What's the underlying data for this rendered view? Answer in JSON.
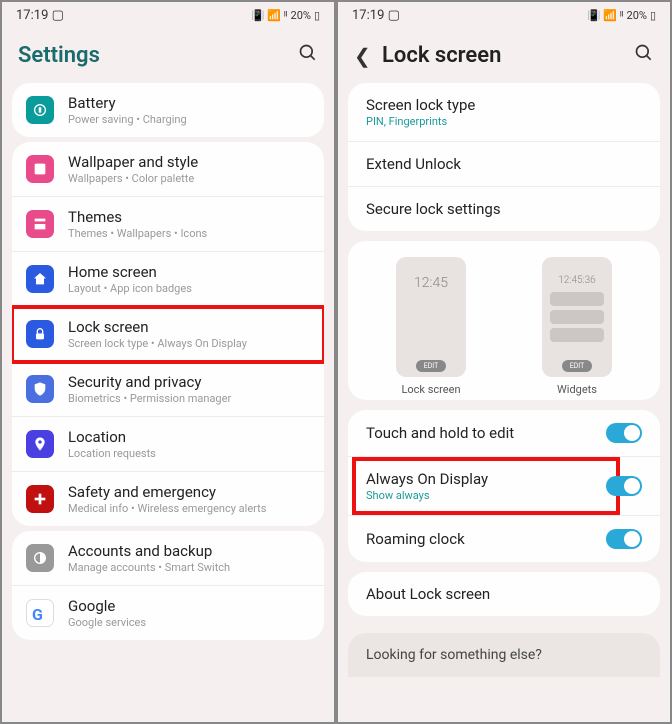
{
  "status": {
    "time": "17:19",
    "battery": "20%"
  },
  "left": {
    "header": "Settings",
    "groups": [
      {
        "items": [
          {
            "id": "battery",
            "icon": "battery-icon",
            "color": "#0a9b9b",
            "title": "Battery",
            "sub": "Power saving  •  Charging"
          }
        ]
      },
      {
        "items": [
          {
            "id": "wallpaper",
            "icon": "wallpaper-icon",
            "color": "#e94b8a",
            "title": "Wallpaper and style",
            "sub": "Wallpapers  •  Color palette"
          },
          {
            "id": "themes",
            "icon": "themes-icon",
            "color": "#e94b8a",
            "title": "Themes",
            "sub": "Themes  •  Wallpapers  •  Icons"
          },
          {
            "id": "home",
            "icon": "home-icon",
            "color": "#2a5ae0",
            "title": "Home screen",
            "sub": "Layout  •  App icon badges"
          },
          {
            "id": "lock",
            "icon": "lock-icon",
            "color": "#2a5ae0",
            "title": "Lock screen",
            "sub": "Screen lock type  •  Always On Display",
            "highlight": true
          },
          {
            "id": "security",
            "icon": "shield-icon",
            "color": "#4a6fe0",
            "title": "Security and privacy",
            "sub": "Biometrics  •  Permission manager"
          },
          {
            "id": "location",
            "icon": "location-icon",
            "color": "#4a3fe0",
            "title": "Location",
            "sub": "Location requests"
          },
          {
            "id": "safety",
            "icon": "safety-icon",
            "color": "#c01010",
            "title": "Safety and emergency",
            "sub": "Medical info  •  Wireless emergency alerts"
          }
        ]
      },
      {
        "items": [
          {
            "id": "accounts",
            "icon": "accounts-icon",
            "color": "#999",
            "title": "Accounts and backup",
            "sub": "Manage accounts  •  Smart Switch"
          },
          {
            "id": "google",
            "icon": "google-icon",
            "color": "#fff",
            "title": "Google",
            "sub": "Google services"
          }
        ]
      }
    ]
  },
  "right": {
    "header": "Lock screen",
    "topItems": [
      {
        "title": "Screen lock type",
        "sub": "PIN, Fingerprints",
        "subTeal": true
      },
      {
        "title": "Extend Unlock"
      },
      {
        "title": "Secure lock settings"
      }
    ],
    "preview": {
      "lock": {
        "time": "12:45",
        "edit": "EDIT",
        "label": "Lock screen"
      },
      "widgets": {
        "time": "12:45:36",
        "edit": "EDIT",
        "label": "Widgets"
      }
    },
    "toggleItems": [
      {
        "title": "Touch and hold to edit",
        "toggle": true
      },
      {
        "title": "Always On Display",
        "sub": "Show always",
        "subTeal": true,
        "toggle": true,
        "highlight": true
      },
      {
        "title": "Roaming clock",
        "toggle": true
      }
    ],
    "about": "About Lock screen",
    "footer": "Looking for something else?"
  }
}
